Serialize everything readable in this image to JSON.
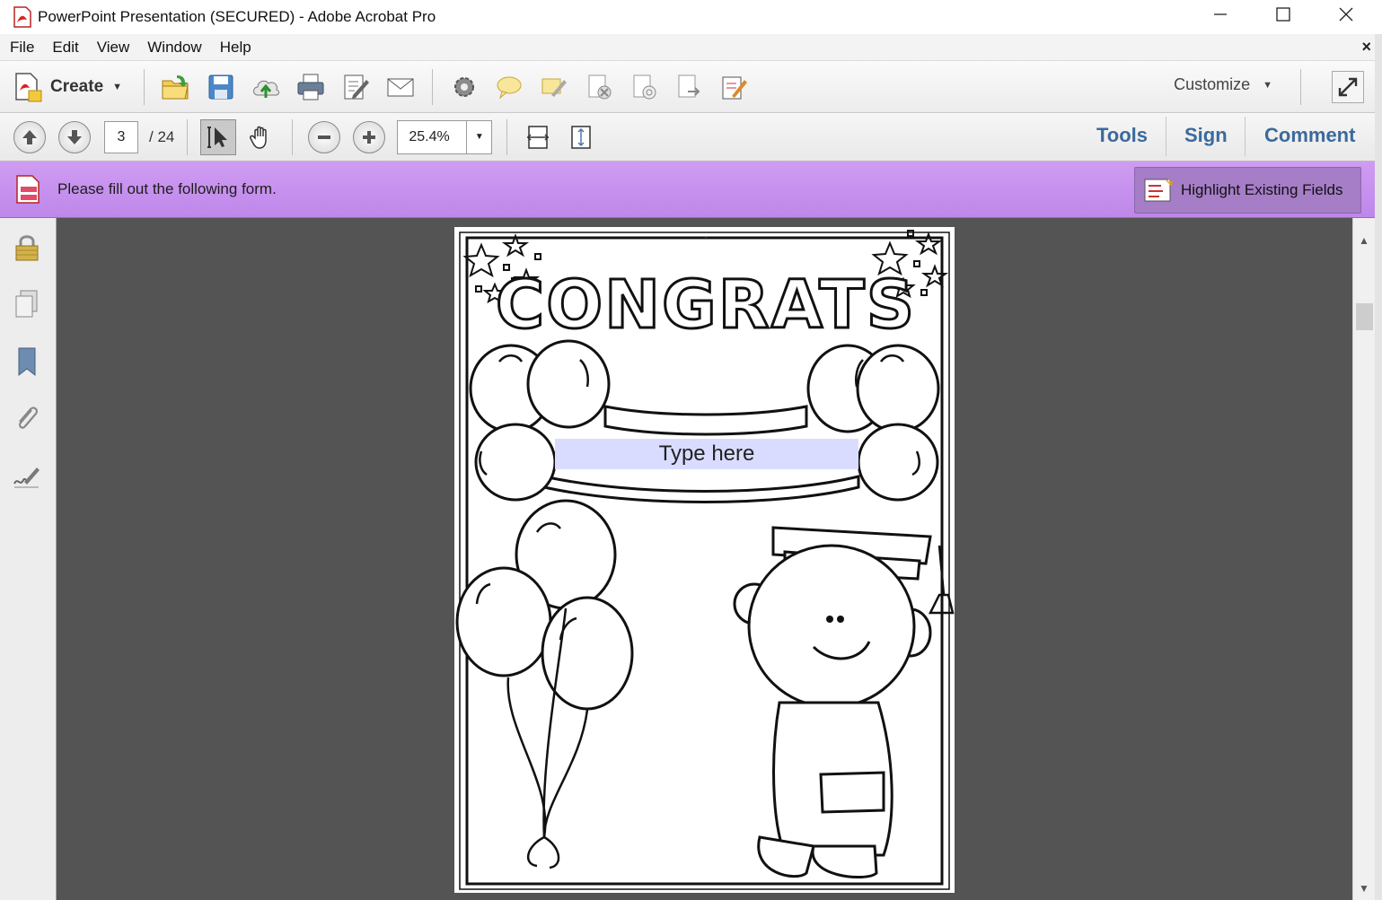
{
  "window": {
    "title": "PowerPoint Presentation (SECURED) - Adobe Acrobat Pro"
  },
  "menu": {
    "items": [
      "File",
      "Edit",
      "View",
      "Window",
      "Help"
    ],
    "close_doc": "×"
  },
  "toolbar": {
    "create_label": "Create",
    "customize_label": "Customize"
  },
  "navigation": {
    "current_page": "3",
    "total_pages": "/ 24",
    "zoom": "25.4%"
  },
  "panels": {
    "tools": "Tools",
    "sign": "Sign",
    "comment": "Comment"
  },
  "form_bar": {
    "message": "Please fill out the following form.",
    "highlight_button": "Highlight Existing Fields",
    "color": "#c594ee"
  },
  "document": {
    "heading": "CONGRATS",
    "form_field_placeholder": "Type here"
  },
  "icons": {
    "left_nav": [
      "lock-icon",
      "pages-icon",
      "bookmark-icon",
      "attachment-icon",
      "signature-icon"
    ],
    "toolbar": [
      "open-icon",
      "save-icon",
      "upload-icon",
      "print-icon",
      "edit-icon",
      "email-icon",
      "settings-icon",
      "comment-bubble-icon",
      "highlight-icon",
      "redact-icon",
      "protect-icon",
      "export-icon",
      "form-edit-icon"
    ]
  }
}
